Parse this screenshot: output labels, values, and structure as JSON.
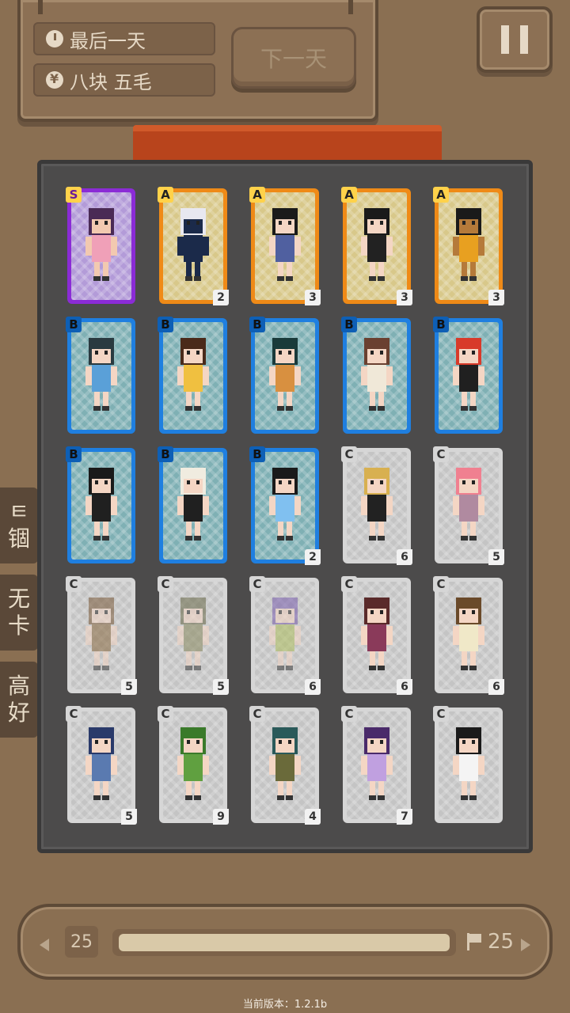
{
  "header": {
    "day_text": "最后一天",
    "money_text": "八块 五毛",
    "next_day_label": "下一天"
  },
  "side_tabs": [
    {
      "label": "ㅌ\n锢"
    },
    {
      "label": "无\n卡"
    },
    {
      "label": "高\n好"
    }
  ],
  "cards": [
    {
      "rank": "S",
      "count": "",
      "hair": "#4a2a55",
      "skin": "#f2c9b0",
      "outfit": "#f0a0b8",
      "dim": false
    },
    {
      "rank": "A",
      "count": "2",
      "hair": "#e8e8f0",
      "skin": "#1b2a4a",
      "outfit": "#1b2a4a",
      "dim": false
    },
    {
      "rank": "A",
      "count": "3",
      "hair": "#1a1a1a",
      "skin": "#f4d6c4",
      "outfit": "#5060a0",
      "dim": false
    },
    {
      "rank": "A",
      "count": "3",
      "hair": "#1a1a1a",
      "skin": "#f4d6c4",
      "outfit": "#222",
      "dim": false
    },
    {
      "rank": "A",
      "count": "3",
      "hair": "#1a1a1a",
      "skin": "#b57a3a",
      "outfit": "#e8a020",
      "dim": false
    },
    {
      "rank": "B",
      "count": "",
      "hair": "#2a3a40",
      "skin": "#f4d6c4",
      "outfit": "#5aa0d8",
      "dim": false
    },
    {
      "rank": "B",
      "count": "",
      "hair": "#4a2a1a",
      "skin": "#f4d6c4",
      "outfit": "#f0c040",
      "dim": false
    },
    {
      "rank": "B",
      "count": "",
      "hair": "#1a3a3a",
      "skin": "#f4d6c4",
      "outfit": "#d89040",
      "dim": false
    },
    {
      "rank": "B",
      "count": "",
      "hair": "#6a4030",
      "skin": "#f4d6c4",
      "outfit": "#f0e8d8",
      "dim": false
    },
    {
      "rank": "B",
      "count": "",
      "hair": "#d83a2a",
      "skin": "#f4d6c4",
      "outfit": "#202020",
      "dim": false
    },
    {
      "rank": "B",
      "count": "",
      "hair": "#1a1a1a",
      "skin": "#f4d6c4",
      "outfit": "#202020",
      "dim": false
    },
    {
      "rank": "B",
      "count": "",
      "hair": "#f0ece0",
      "skin": "#f4d6c4",
      "outfit": "#202020",
      "dim": false
    },
    {
      "rank": "B",
      "count": "2",
      "hair": "#1a1a1a",
      "skin": "#f4d6c4",
      "outfit": "#80c0f0",
      "dim": false
    },
    {
      "rank": "C",
      "count": "6",
      "hair": "#d8b050",
      "skin": "#f4d6c4",
      "outfit": "#222",
      "dim": false
    },
    {
      "rank": "C",
      "count": "5",
      "hair": "#f08090",
      "skin": "#f4d6c4",
      "outfit": "#b08aa0",
      "dim": false
    },
    {
      "rank": "C",
      "count": "5",
      "hair": "#7a5a3a",
      "skin": "#f4d6c4",
      "outfit": "#8a6a40",
      "dim": true
    },
    {
      "rank": "C",
      "count": "5",
      "hair": "#6a6a4a",
      "skin": "#f4d6c4",
      "outfit": "#8a8a60",
      "dim": true
    },
    {
      "rank": "C",
      "count": "6",
      "hair": "#7a60b0",
      "skin": "#f4d6c4",
      "outfit": "#b0c060",
      "dim": true
    },
    {
      "rank": "C",
      "count": "6",
      "hair": "#5a2a2a",
      "skin": "#f4d6c4",
      "outfit": "#8a3a5a",
      "dim": false
    },
    {
      "rank": "C",
      "count": "6",
      "hair": "#6a4a2a",
      "skin": "#f4d6c4",
      "outfit": "#f0e8c8",
      "dim": false
    },
    {
      "rank": "C",
      "count": "5",
      "hair": "#2a3a6a",
      "skin": "#f4d6c4",
      "outfit": "#5a7ab0",
      "dim": false
    },
    {
      "rank": "C",
      "count": "9",
      "hair": "#3a7a2a",
      "skin": "#f4d6c4",
      "outfit": "#60a040",
      "dim": false
    },
    {
      "rank": "C",
      "count": "4",
      "hair": "#2a5a5a",
      "skin": "#f4d6c4",
      "outfit": "#6a6a3a",
      "dim": false
    },
    {
      "rank": "C",
      "count": "7",
      "hair": "#4a2a6a",
      "skin": "#f4d6c4",
      "outfit": "#c0a0e0",
      "dim": false
    },
    {
      "rank": "C",
      "count": "",
      "hair": "#1a1a1a",
      "skin": "#f4d6c4",
      "outfit": "#f4f4f4",
      "dim": false
    }
  ],
  "progress": {
    "current_day": "25",
    "goal": "25",
    "fraction": 1.0
  },
  "footer": {
    "version": "当前版本：1.2.1b"
  }
}
